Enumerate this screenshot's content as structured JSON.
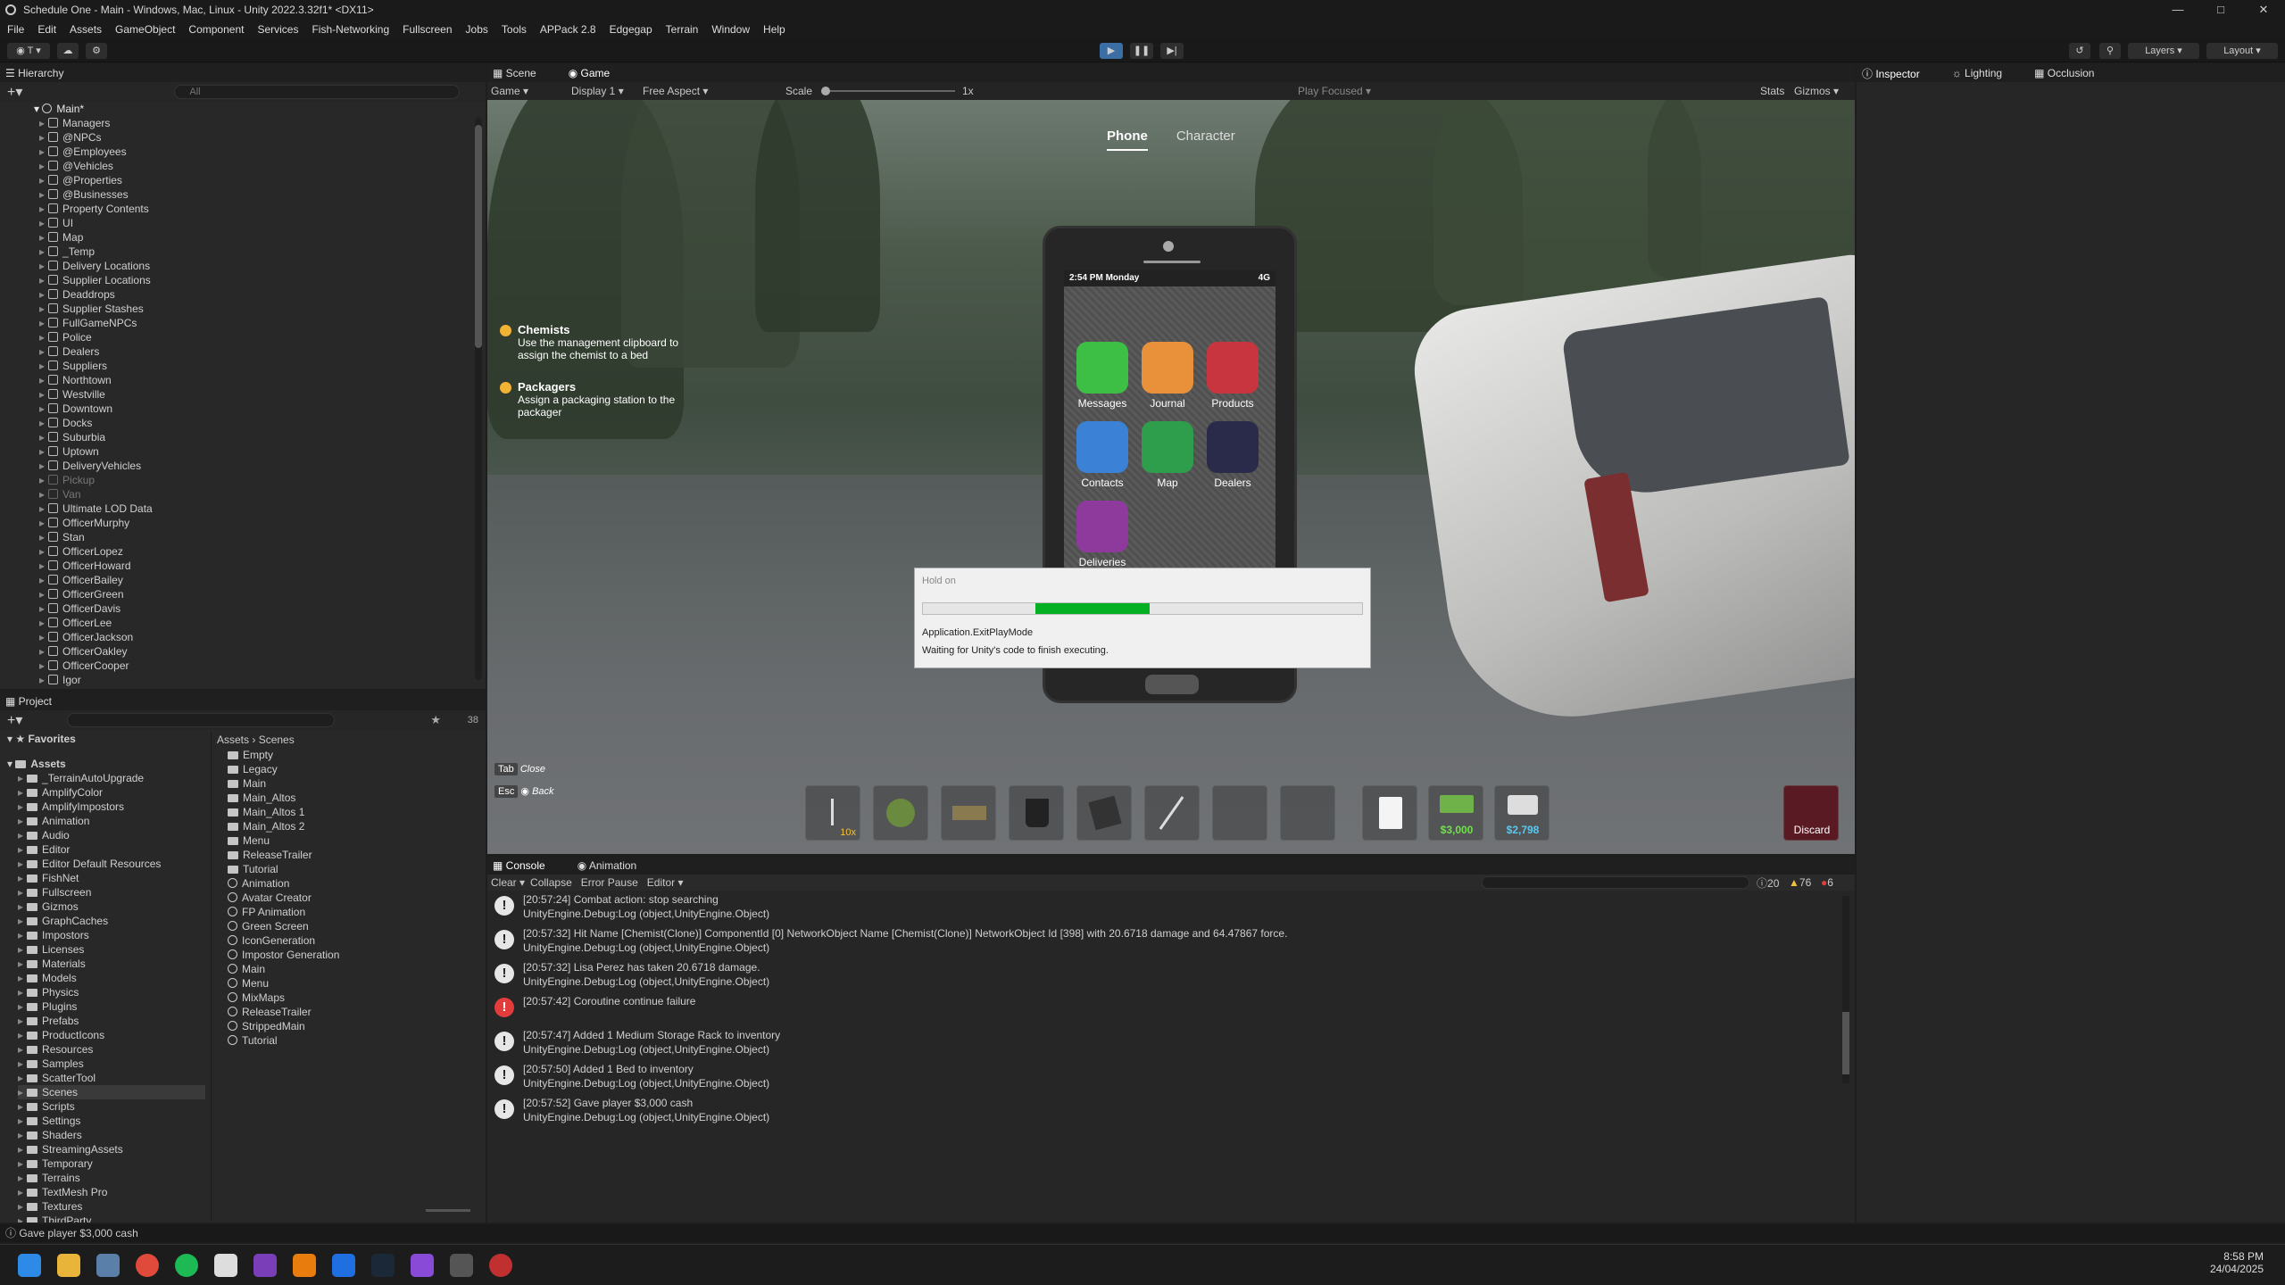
{
  "window": {
    "title": "Schedule One - Main - Windows, Mac, Linux - Unity 2022.3.32f1* <DX11>"
  },
  "menu": [
    "File",
    "Edit",
    "Assets",
    "GameObject",
    "Component",
    "Services",
    "Fish-Networking",
    "Fullscreen",
    "Jobs",
    "Tools",
    "APPack 2.8",
    "Edgegap",
    "Terrain",
    "Window",
    "Help"
  ],
  "toolbar": {
    "layers": "Layers",
    "layout": "Layout"
  },
  "hierarchy": {
    "tab": "Hierarchy",
    "search_placeholder": "All",
    "root": "Main*",
    "items": [
      {
        "label": "Managers",
        "dim": false
      },
      {
        "label": "@NPCs",
        "dim": false
      },
      {
        "label": "@Employees",
        "dim": false
      },
      {
        "label": "@Vehicles",
        "dim": false
      },
      {
        "label": "@Properties",
        "dim": false
      },
      {
        "label": "@Businesses",
        "dim": false
      },
      {
        "label": "Property Contents",
        "dim": false
      },
      {
        "label": "UI",
        "dim": false
      },
      {
        "label": "Map",
        "dim": false
      },
      {
        "label": "_Temp",
        "dim": false
      },
      {
        "label": "Delivery Locations",
        "dim": false
      },
      {
        "label": "Supplier Locations",
        "dim": false
      },
      {
        "label": "Deaddrops",
        "dim": false
      },
      {
        "label": "Supplier Stashes",
        "dim": false
      },
      {
        "label": "FullGameNPCs",
        "dim": false
      },
      {
        "label": "Police",
        "dim": false
      },
      {
        "label": "Dealers",
        "dim": false
      },
      {
        "label": "Suppliers",
        "dim": false
      },
      {
        "label": "Northtown",
        "dim": false
      },
      {
        "label": "Westville",
        "dim": false
      },
      {
        "label": "Downtown",
        "dim": false
      },
      {
        "label": "Docks",
        "dim": false
      },
      {
        "label": "Suburbia",
        "dim": false
      },
      {
        "label": "Uptown",
        "dim": false
      },
      {
        "label": "DeliveryVehicles",
        "dim": false
      },
      {
        "label": "Pickup",
        "dim": true
      },
      {
        "label": "Van",
        "dim": true
      },
      {
        "label": "Ultimate LOD Data",
        "dim": false
      },
      {
        "label": "OfficerMurphy",
        "dim": false
      },
      {
        "label": "Stan",
        "dim": false
      },
      {
        "label": "OfficerLopez",
        "dim": false
      },
      {
        "label": "OfficerHoward",
        "dim": false
      },
      {
        "label": "OfficerBailey",
        "dim": false
      },
      {
        "label": "OfficerGreen",
        "dim": false
      },
      {
        "label": "OfficerDavis",
        "dim": false
      },
      {
        "label": "OfficerLee",
        "dim": false
      },
      {
        "label": "OfficerJackson",
        "dim": false
      },
      {
        "label": "OfficerOakley",
        "dim": false
      },
      {
        "label": "OfficerCooper",
        "dim": false
      },
      {
        "label": "Igor",
        "dim": false
      }
    ]
  },
  "project": {
    "tab": "Project",
    "count": "38",
    "favorites": "Favorites",
    "assets_root": "Assets",
    "breadcrumb": [
      "Assets",
      "Scenes"
    ],
    "tree": [
      "_TerrainAutoUpgrade",
      "AmplifyColor",
      "AmplifyImpostors",
      "Animation",
      "Audio",
      "Editor",
      "Editor Default Resources",
      "FishNet",
      "Fullscreen",
      "Gizmos",
      "GraphCaches",
      "Impostors",
      "Licenses",
      "Materials",
      "Models",
      "Physics",
      "Plugins",
      "Prefabs",
      "ProductIcons",
      "Resources",
      "Samples",
      "ScatterTool",
      "Scenes",
      "Scripts",
      "Settings",
      "Shaders",
      "StreamingAssets",
      "Temporary",
      "Terrains",
      "TextMesh Pro",
      "Textures",
      "ThirdParty"
    ],
    "selected_tree": "Scenes",
    "folders": [
      "Empty",
      "Legacy",
      "Main",
      "Main_Altos",
      "Main_Altos 1",
      "Main_Altos 2",
      "Menu",
      "ReleaseTrailer",
      "Tutorial"
    ],
    "scenes": [
      "Animation",
      "Avatar Creator",
      "FP Animation",
      "Green Screen",
      "IconGeneration",
      "Impostor Generation",
      "Main",
      "Menu",
      "MixMaps",
      "ReleaseTrailer",
      "StrippedMain",
      "Tutorial"
    ]
  },
  "scene_tabs": [
    "Scene",
    "Game"
  ],
  "game_toolbar": {
    "mode": "Game",
    "display": "Display 1",
    "aspect": "Free Aspect",
    "scale_label": "Scale",
    "scale_value": "1x",
    "play_focused": "Play Focused",
    "stats": "Stats",
    "gizmos": "Gizmos"
  },
  "right_tabs": [
    "Inspector",
    "Lighting",
    "Occlusion"
  ],
  "game": {
    "top_tabs": [
      "Phone",
      "Character"
    ],
    "quests": [
      {
        "title": "Chemists",
        "line1": "Use the management clipboard to",
        "line2": "assign the chemist to a bed"
      },
      {
        "title": "Packagers",
        "line1": "Assign a packaging station to the",
        "line2": "packager"
      }
    ],
    "phone": {
      "time": "2:54 PM Monday",
      "signal": "4G",
      "apps": [
        {
          "label": "Messages",
          "color": "#3dbf45"
        },
        {
          "label": "Journal",
          "color": "#e9913a"
        },
        {
          "label": "Products",
          "color": "#c8353f"
        },
        {
          "label": "Contacts",
          "color": "#3b82d6"
        },
        {
          "label": "Map",
          "color": "#2f9e4c"
        },
        {
          "label": "Dealers",
          "color": "#2a2a4a"
        },
        {
          "label": "Deliveries",
          "color": "#8e3a9c"
        }
      ]
    },
    "hints": [
      {
        "key": "Tab",
        "label": "Close"
      },
      {
        "key": "Esc",
        "label": "Back"
      }
    ],
    "hotbar": {
      "stack": "10x",
      "cash": "$3,000",
      "bank": "$2,798",
      "discard": "Discard"
    }
  },
  "dialog": {
    "title": "Hold on",
    "progress": 0.26,
    "action": "Application.ExitPlayMode",
    "message": "Waiting for Unity's code to finish executing."
  },
  "console": {
    "tabs": [
      "Console",
      "Animation"
    ],
    "toolbar": [
      "Clear",
      "Collapse",
      "Error Pause",
      "Editor"
    ],
    "counts": {
      "info": "20",
      "warn": "76",
      "error": "6"
    },
    "logs": [
      {
        "type": "info",
        "line1": "[20:57:24] Combat action: stop searching",
        "line2": "UnityEngine.Debug:Log (object,UnityEngine.Object)"
      },
      {
        "type": "info",
        "line1": "[20:57:32] Hit Name [Chemist(Clone)] ComponentId [0] NetworkObject Name [Chemist(Clone)] NetworkObject Id [398] with 20.6718 damage and 64.47867 force.",
        "line2": "UnityEngine.Debug:Log (object,UnityEngine.Object)"
      },
      {
        "type": "info",
        "line1": "[20:57:32] Lisa Perez has taken 20.6718 damage.",
        "line2": "UnityEngine.Debug:Log (object,UnityEngine.Object)"
      },
      {
        "type": "error",
        "line1": "[20:57:42] Coroutine continue failure",
        "line2": ""
      },
      {
        "type": "info",
        "line1": "[20:57:47] Added 1 Medium Storage Rack to inventory",
        "line2": "UnityEngine.Debug:Log (object,UnityEngine.Object)"
      },
      {
        "type": "info",
        "line1": "[20:57:50] Added 1 Bed to inventory",
        "line2": "UnityEngine.Debug:Log (object,UnityEngine.Object)"
      },
      {
        "type": "info",
        "line1": "[20:57:52] Gave player $3,000 cash",
        "line2": "UnityEngine.Debug:Log (object,UnityEngine.Object)"
      }
    ]
  },
  "statusbar": {
    "message": "Gave player $3,000 cash"
  },
  "taskbar": {
    "time": "8:58 PM",
    "date": "24/04/2025"
  }
}
